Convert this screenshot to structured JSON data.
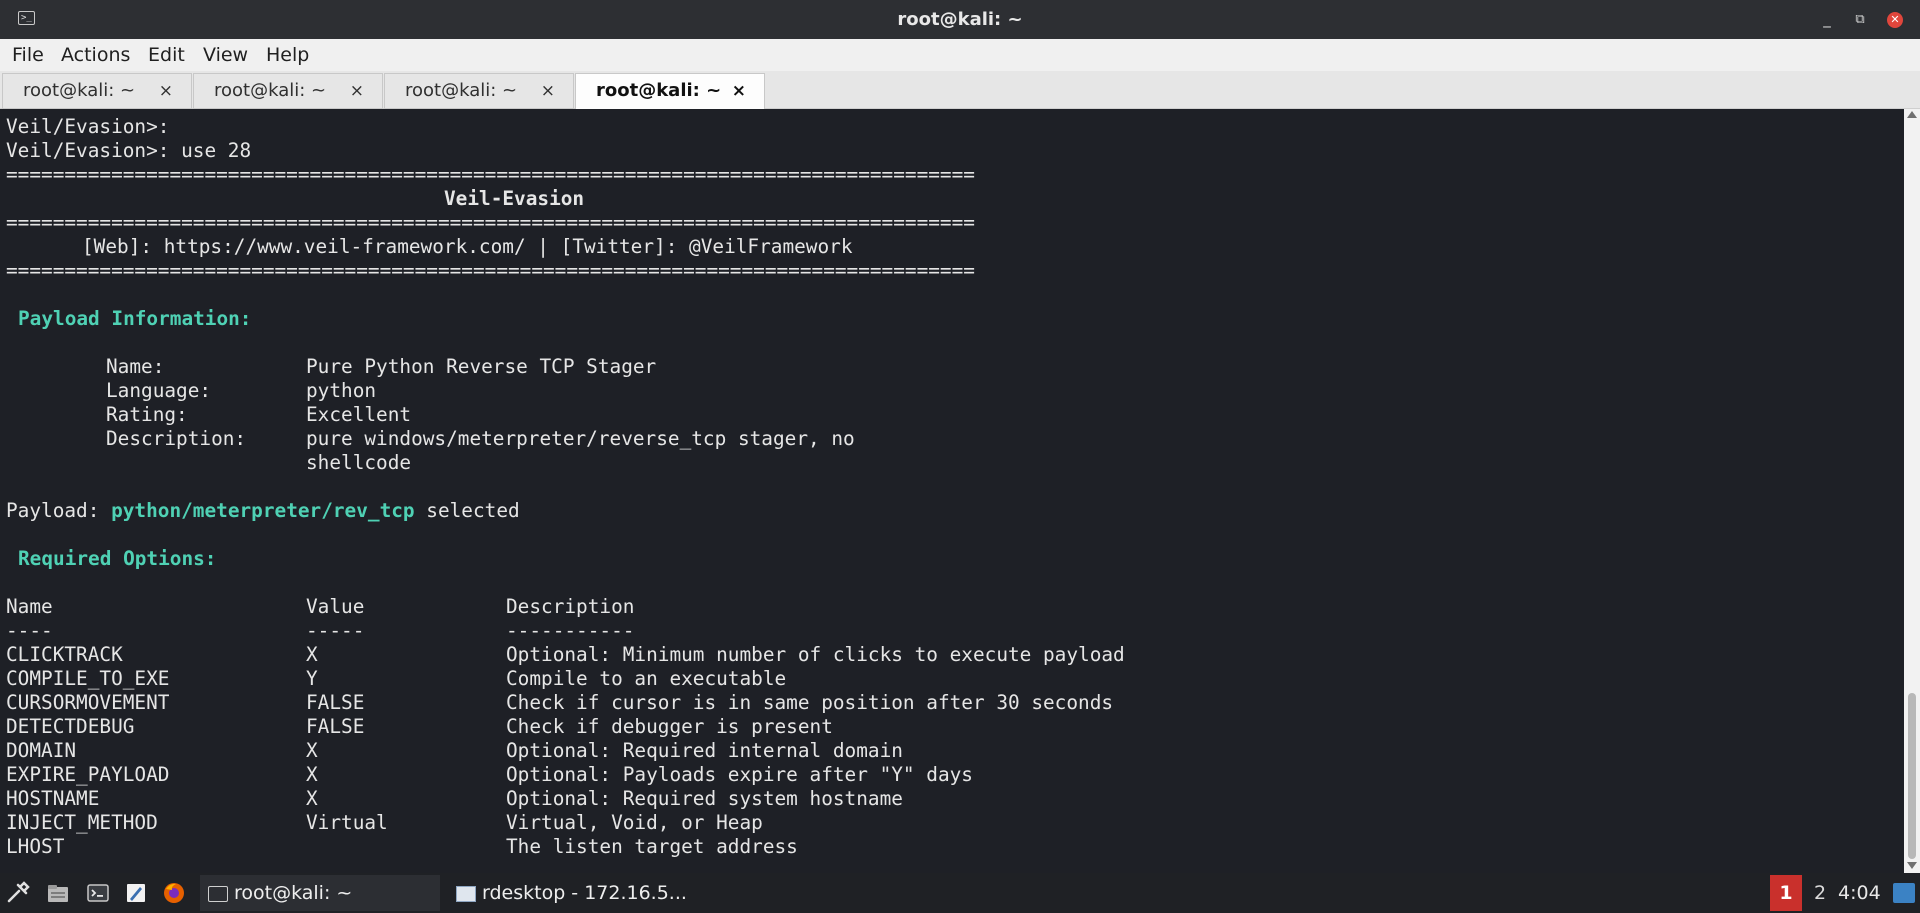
{
  "window": {
    "title": "root@kali: ~",
    "controls": {
      "minimize": "_",
      "maximize": "⧉",
      "close": "✕"
    }
  },
  "menu": [
    "File",
    "Actions",
    "Edit",
    "View",
    "Help"
  ],
  "tabs": [
    {
      "label": "root@kali: ~",
      "active": false
    },
    {
      "label": "root@kali: ~",
      "active": false
    },
    {
      "label": "root@kali: ~",
      "active": false
    },
    {
      "label": "root@kali: ~",
      "active": true
    }
  ],
  "tab_close": "×",
  "terminal": {
    "prompt_empty": "Veil/Evasion>:",
    "prompt_cmd": "Veil/Evasion>: use 28",
    "separator": "===================================================================================",
    "banner_title": "Veil-Evasion",
    "banner_links": "[Web]: https://www.veil-framework.com/ | [Twitter]: @VeilFramework",
    "payload_info_heading": "Payload Information:",
    "info": [
      {
        "key": "Name:",
        "value": "Pure Python Reverse TCP Stager"
      },
      {
        "key": "Language:",
        "value": "python"
      },
      {
        "key": "Rating:",
        "value": "Excellent"
      },
      {
        "key": "Description:",
        "value": "pure windows/meterpreter/reverse_tcp stager, no"
      }
    ],
    "description_cont": "shellcode",
    "payload_prefix": "Payload: ",
    "payload_name": "python/meterpreter/rev_tcp",
    "payload_suffix": " selected",
    "required_heading": "Required Options:",
    "columns": {
      "name": "Name",
      "value": "Value",
      "description": "Description"
    },
    "underlines": {
      "name": "----",
      "value": "-----",
      "description": "-----------"
    },
    "options": [
      {
        "name": "CLICKTRACK",
        "value": "X",
        "description": "Optional: Minimum number of clicks to execute payload"
      },
      {
        "name": "COMPILE_TO_EXE",
        "value": "Y",
        "description": "Compile to an executable"
      },
      {
        "name": "CURSORMOVEMENT",
        "value": "FALSE",
        "description": "Check if cursor is in same position after 30 seconds"
      },
      {
        "name": "DETECTDEBUG",
        "value": "FALSE",
        "description": "Check if debugger is present"
      },
      {
        "name": "DOMAIN",
        "value": "X",
        "description": "Optional: Required internal domain"
      },
      {
        "name": "EXPIRE_PAYLOAD",
        "value": "X",
        "description": "Optional: Payloads expire after \"Y\" days"
      },
      {
        "name": "HOSTNAME",
        "value": "X",
        "description": "Optional: Required system hostname"
      },
      {
        "name": "INJECT_METHOD",
        "value": "Virtual",
        "description": "Virtual, Void, or Heap"
      },
      {
        "name": "LHOST",
        "value": "",
        "description": "The listen target address"
      }
    ]
  },
  "taskbar": {
    "tasks": [
      "root@kali: ~",
      "rdesktop - 172.16.5..."
    ],
    "workspaces": [
      "1",
      "2"
    ],
    "active_workspace": "1",
    "clock": "4:04"
  },
  "colors": {
    "accent": "#4fd1b4",
    "terminal_bg": "#1e2026",
    "workspace_active": "#c9302c"
  }
}
